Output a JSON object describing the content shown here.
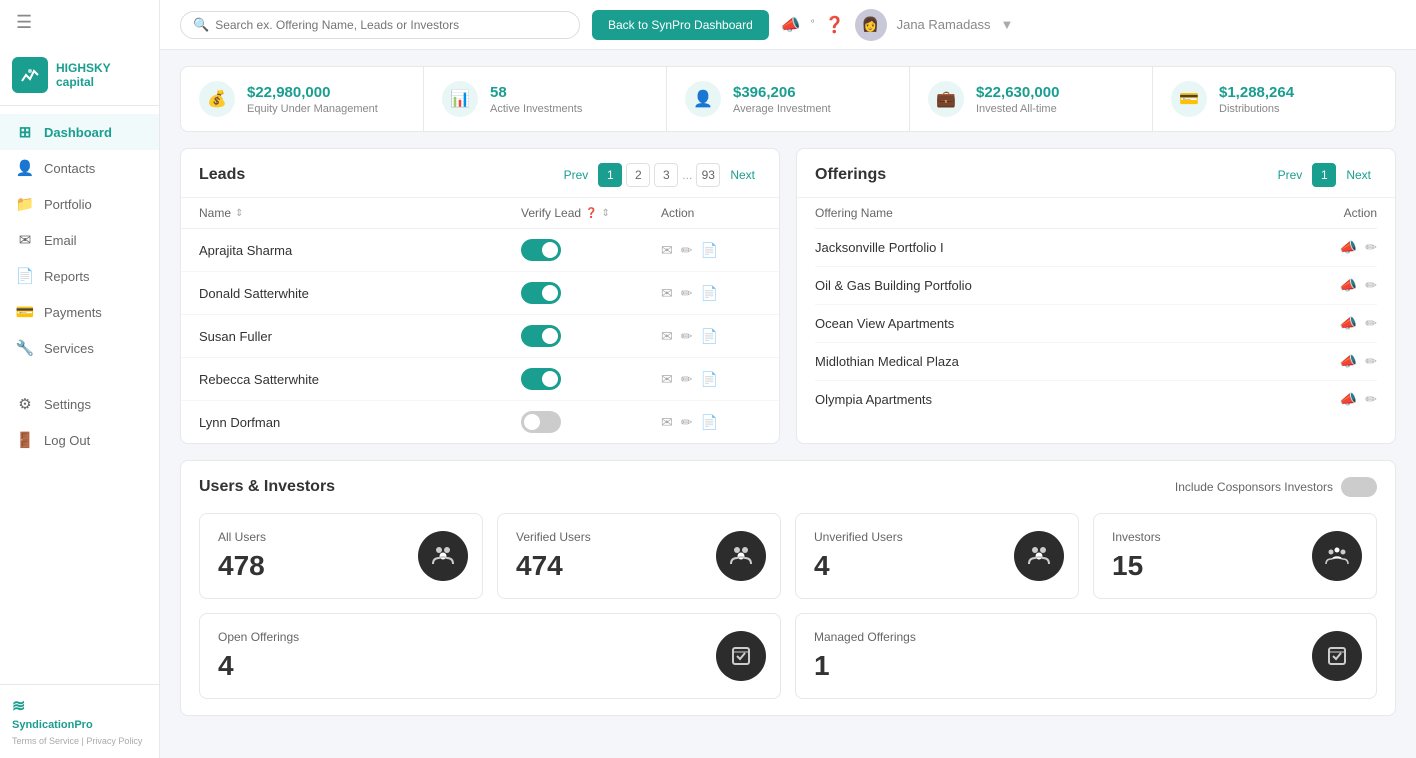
{
  "app": {
    "title": "HighSky Capital",
    "logo_text": "HIGHSKY\ncapital"
  },
  "header": {
    "search_placeholder": "Search ex. Offering Name, Leads or Investors",
    "dashboard_button": "Back to SynPro Dashboard",
    "username": "Jana Ramadass"
  },
  "sidebar": {
    "items": [
      {
        "label": "Dashboard",
        "icon": "⊞",
        "active": true
      },
      {
        "label": "Contacts",
        "icon": "👤"
      },
      {
        "label": "Portfolio",
        "icon": "📁"
      },
      {
        "label": "Email",
        "icon": "✉"
      },
      {
        "label": "Reports",
        "icon": "📄"
      },
      {
        "label": "Payments",
        "icon": "💳"
      },
      {
        "label": "Services",
        "icon": "🔧"
      },
      {
        "label": "Settings",
        "icon": "⚙"
      },
      {
        "label": "Log Out",
        "icon": "🚪"
      }
    ]
  },
  "stats": [
    {
      "value": "$22,980,000",
      "label": "Equity Under Management",
      "icon": "💰"
    },
    {
      "value": "58",
      "label": "Active Investments",
      "icon": "📊"
    },
    {
      "value": "$396,206",
      "label": "Average Investment",
      "icon": "👤"
    },
    {
      "value": "$22,630,000",
      "label": "Invested All-time",
      "icon": "💼"
    },
    {
      "value": "$1,288,264",
      "label": "Distributions",
      "icon": "💳"
    }
  ],
  "leads": {
    "title": "Leads",
    "pagination": {
      "prev": "Prev",
      "next": "Next",
      "pages": [
        "1",
        "2",
        "3",
        "...",
        "93"
      ]
    },
    "columns": {
      "name": "Name",
      "verify_lead": "Verify Lead",
      "action": "Action"
    },
    "rows": [
      {
        "name": "Aprajita Sharma",
        "verified": true
      },
      {
        "name": "Donald Satterwhite",
        "verified": true
      },
      {
        "name": "Susan Fuller",
        "verified": true
      },
      {
        "name": "Rebecca Satterwhite",
        "verified": true
      },
      {
        "name": "Lynn Dorfman",
        "verified": false
      }
    ]
  },
  "offerings": {
    "title": "Offerings",
    "pagination": {
      "prev": "Prev",
      "next": "Next",
      "pages": [
        "1"
      ]
    },
    "columns": {
      "name": "Offering Name",
      "action": "Action"
    },
    "rows": [
      {
        "name": "Jacksonville Portfolio I"
      },
      {
        "name": "Oil & Gas Building Portfolio"
      },
      {
        "name": "Ocean View Apartments"
      },
      {
        "name": "Midlothian Medical Plaza"
      },
      {
        "name": "Olympia Apartments"
      }
    ]
  },
  "users_investors": {
    "title": "Users & Investors",
    "include_label": "Include Cosponsors Investors",
    "cards": [
      {
        "label": "All Users",
        "value": "478"
      },
      {
        "label": "Verified Users",
        "value": "474"
      },
      {
        "label": "Unverified Users",
        "value": "4"
      },
      {
        "label": "Investors",
        "value": "15"
      }
    ],
    "bottom_cards": [
      {
        "label": "Open Offerings",
        "value": "4"
      },
      {
        "label": "Managed Offerings",
        "value": "1"
      }
    ]
  },
  "syndication": {
    "text": "SyndicationPro",
    "terms": "Terms of Service",
    "privacy": "Privacy Policy"
  }
}
